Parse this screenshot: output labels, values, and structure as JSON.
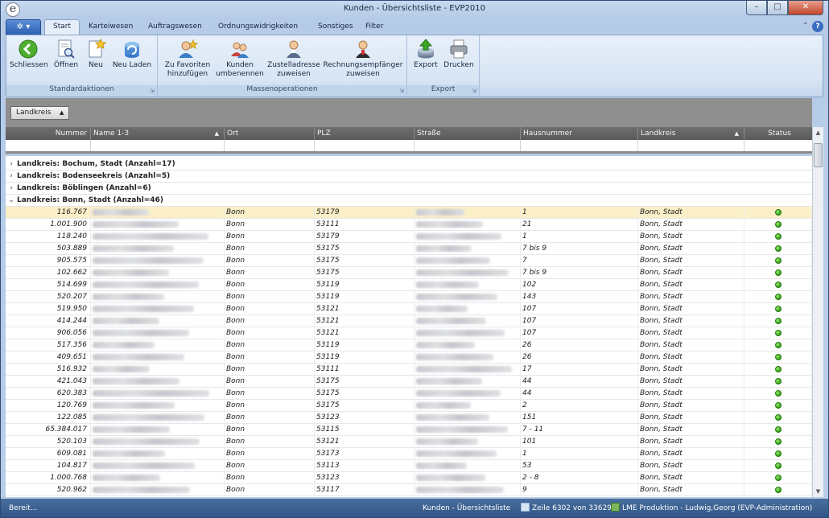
{
  "window": {
    "title": "Kunden - Übersichtsliste - EVP2010",
    "app_icon_glyph": "e"
  },
  "ribbon_tabs": [
    "Start",
    "Karteiwesen",
    "Auftragswesen",
    "Ordnungswidrigkeiten",
    "Sonstiges",
    "Filter"
  ],
  "ribbon": {
    "standard": {
      "label": "Standardaktionen",
      "buttons": [
        "Schliessen",
        "Öffnen",
        "Neu",
        "Neu Laden"
      ]
    },
    "mass": {
      "label": "Massenoperationen",
      "b1": [
        "Zu Favoriten",
        "hinzufügen"
      ],
      "b2": [
        "Kunden",
        "umbenennen"
      ],
      "b3": [
        "Zustelladresse",
        "zuweisen"
      ],
      "b4": [
        "Rechnungsempfänger",
        "zuweisen"
      ]
    },
    "export": {
      "label": "Export",
      "buttons": [
        "Export",
        "Drucken"
      ]
    }
  },
  "groupby": {
    "chip": "Landkreis"
  },
  "columns": [
    "Nummer",
    "Name 1-3",
    "Ort",
    "PLZ",
    "Straße",
    "Hausnummer",
    "Landkreis",
    "Status"
  ],
  "groups": [
    {
      "label": "Landkreis: Bochum, Stadt (Anzahl=17)",
      "expanded": false
    },
    {
      "label": "Landkreis: Bodenseekreis (Anzahl=5)",
      "expanded": false
    },
    {
      "label": "Landkreis: Böblingen (Anzahl=6)",
      "expanded": false
    },
    {
      "label": "Landkreis: Bonn, Stadt (Anzahl=46)",
      "expanded": true
    }
  ],
  "rows": [
    {
      "nummer": "116.767",
      "ort": "Bonn",
      "plz": "53179",
      "hausnummer": "1",
      "landkreis": "Bonn, Stadt",
      "selected": true
    },
    {
      "nummer": "1.001.900",
      "ort": "Bonn",
      "plz": "53111",
      "hausnummer": "21",
      "landkreis": "Bonn, Stadt"
    },
    {
      "nummer": "118.240",
      "ort": "Bonn",
      "plz": "53179",
      "hausnummer": "1",
      "landkreis": "Bonn, Stadt"
    },
    {
      "nummer": "503.889",
      "ort": "Bonn",
      "plz": "53175",
      "hausnummer": "7 bis 9",
      "landkreis": "Bonn, Stadt"
    },
    {
      "nummer": "905.575",
      "ort": "Bonn",
      "plz": "53175",
      "hausnummer": "7",
      "landkreis": "Bonn, Stadt"
    },
    {
      "nummer": "102.662",
      "ort": "Bonn",
      "plz": "53175",
      "hausnummer": "7 bis 9",
      "landkreis": "Bonn, Stadt"
    },
    {
      "nummer": "514.699",
      "ort": "Bonn",
      "plz": "53119",
      "hausnummer": "102",
      "landkreis": "Bonn, Stadt"
    },
    {
      "nummer": "520.207",
      "ort": "Bonn",
      "plz": "53119",
      "hausnummer": "143",
      "landkreis": "Bonn, Stadt"
    },
    {
      "nummer": "519.950",
      "ort": "Bonn",
      "plz": "53121",
      "hausnummer": "107",
      "landkreis": "Bonn, Stadt"
    },
    {
      "nummer": "414.244",
      "ort": "Bonn",
      "plz": "53121",
      "hausnummer": "107",
      "landkreis": "Bonn, Stadt"
    },
    {
      "nummer": "906.056",
      "ort": "Bonn",
      "plz": "53121",
      "hausnummer": "107",
      "landkreis": "Bonn, Stadt"
    },
    {
      "nummer": "517.356",
      "ort": "Bonn",
      "plz": "53119",
      "hausnummer": "26",
      "landkreis": "Bonn, Stadt"
    },
    {
      "nummer": "409.651",
      "ort": "Bonn",
      "plz": "53119",
      "hausnummer": "26",
      "landkreis": "Bonn, Stadt"
    },
    {
      "nummer": "516.932",
      "ort": "Bonn",
      "plz": "53111",
      "hausnummer": "17",
      "landkreis": "Bonn, Stadt"
    },
    {
      "nummer": "421.043",
      "ort": "Bonn",
      "plz": "53175",
      "hausnummer": "44",
      "landkreis": "Bonn, Stadt"
    },
    {
      "nummer": "620.383",
      "ort": "Bonn",
      "plz": "53175",
      "hausnummer": "44",
      "landkreis": "Bonn, Stadt"
    },
    {
      "nummer": "120.769",
      "ort": "Bonn",
      "plz": "53175",
      "hausnummer": "2",
      "landkreis": "Bonn, Stadt"
    },
    {
      "nummer": "122.085",
      "ort": "Bonn",
      "plz": "53123",
      "hausnummer": "151",
      "landkreis": "Bonn, Stadt"
    },
    {
      "nummer": "65.384.017",
      "ort": "Bonn",
      "plz": "53115",
      "hausnummer": "7 - 11",
      "landkreis": "Bonn, Stadt"
    },
    {
      "nummer": "520.103",
      "ort": "Bonn",
      "plz": "53121",
      "hausnummer": "101",
      "landkreis": "Bonn, Stadt"
    },
    {
      "nummer": "609.081",
      "ort": "Bonn",
      "plz": "53173",
      "hausnummer": "1",
      "landkreis": "Bonn, Stadt"
    },
    {
      "nummer": "104.817",
      "ort": "Bonn",
      "plz": "53113",
      "hausnummer": "53",
      "landkreis": "Bonn, Stadt"
    },
    {
      "nummer": "1.000.768",
      "ort": "Bonn",
      "plz": "53123",
      "hausnummer": "2 - 8",
      "landkreis": "Bonn, Stadt"
    },
    {
      "nummer": "520.962",
      "ort": "Bonn",
      "plz": "53117",
      "hausnummer": "9",
      "landkreis": "Bonn, Stadt"
    }
  ],
  "status_color": "#2c9a14",
  "statusbar": {
    "left": "Bereit...",
    "view": "Kunden - Übersichtsliste",
    "rowinfo": "Zeile 6302 von 33629",
    "user": "LME Produktion - Ludwig,Georg (EVP-Administration)"
  }
}
